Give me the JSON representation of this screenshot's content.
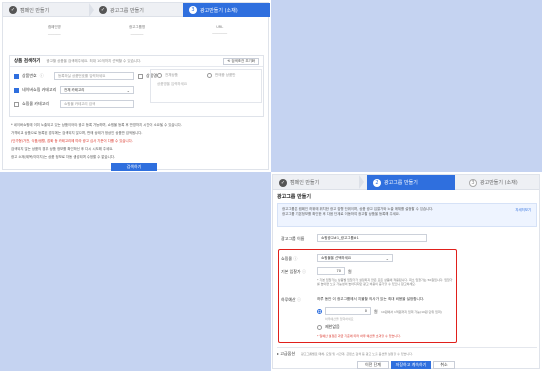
{
  "panel1": {
    "steps": [
      {
        "num": "✓",
        "label": "캠페인 만들기"
      },
      {
        "num": "✓",
        "label": "광고그룹 만들기"
      },
      {
        "num": "3",
        "label": "광고만들기 (소재)"
      }
    ],
    "info": [
      {
        "label": "캠페인명",
        "value": "──────"
      },
      {
        "label": "광고그룹명",
        "value": "──────"
      },
      {
        "label": "URL",
        "value": "───────"
      }
    ],
    "section_title": "상품 검색하기",
    "section_sub": "광고할 상품을 검색해주세요. 최대 10개까지 선택할 수 있습니다.",
    "reset_button": "⟲ 검색조건 초기화",
    "rows": {
      "product_id": {
        "label": "상품번호",
        "placeholder": "등록하실 상품번호를 입력하세요"
      },
      "category": {
        "label": "네이버쇼핑 카테고리",
        "value": "전체 카테고리"
      },
      "mall": {
        "label": "쇼핑몰 카테고리",
        "placeholder": "쇼핑몰 카테고리 검색"
      },
      "product_name": {
        "label": "상품명"
      },
      "right_opt1": "전체상품",
      "right_opt2": "판매중 상품만",
      "right_hint": "상품명을 입력하세요"
    },
    "notes": [
      "* 네이버쇼핑에 이미 노출되고 있는 상품이어야 광고 등록 가능하며, 쇼핑몰 등록 후 반영까지 시간이 소요될 수 있습니다.",
      "가격비교 상품으로 등록된 경우에는 검색되지 않으며, 판매 상태가 정상인 상품만 검색됩니다.",
      "(단가형)가전, 식품/생활, 잡화 등 카테고리에 따라 광고 심사 기준이 다를 수 있습니다.",
      "검색되지 않는 상품의 경우 상품 정보를 확인하신 후 다시 시도해 주세요.",
      "광고 소재(제목/이미지)는 상품 정보로 자동 생성되며 수정할 수 없습니다."
    ],
    "search_button": "검색하기"
  },
  "panel2": {
    "steps": [
      {
        "num": "✓",
        "label": "캠페인 만들기"
      },
      {
        "num": "2",
        "label": "광고그룹 만들기"
      },
      {
        "num": "3",
        "label": "광고만들기 (소재)"
      }
    ],
    "title": "광고그룹 만들기",
    "notice_lines": [
      "광고그룹은 캠페인 하위에 위치한 광고 집행 단위이며, 상품 광고 입찰가와 노출 매체를 설정할 수 있습니다.",
      "광고그룹 기본정보를 확인한 후 다음 단계로 이동하여 광고할 상품을 등록해 주세요."
    ],
    "notice_link": "자세히보기",
    "group_name_label": "광고그룹 이름",
    "group_name_value": "쇼핑광고#1_광고그룹#1",
    "mall_label": "쇼핑몰",
    "mall_value": "쇼핑몰을 선택하세요",
    "bid_label": "기본 입찰가",
    "bid_value": "70",
    "bid_unit": "원",
    "bid_note": "* 기본 입찰가는 상품별 입찰가가 설정되지 않은 모든 상품에 적용됩니다. 최소 입찰가는 50원입니다. 입찰가를 높이면 노출 가능성이 높아지지만 광고 비용이 증가할 수 있으니 참고하세요.",
    "budget_label": "하루예산",
    "budget_desc": "하루 동안 이 광고그룹에서 지불할 의사가 있는 최대 비용을 설정합니다.",
    "budget_value": "0",
    "budget_unit": "원",
    "budget_note": "10원에서 1억원까지 입력 가능(10원 단위 입력)",
    "budget_hint": "하루예산을 입력하세요",
    "unlimited_label": "제한없음",
    "budget_warn": "* 일예산 설정은 과금 기준에 따라 하루 예산을 초과할 수 있습니다.",
    "advanced_label": "고급옵션",
    "advanced_desc": "광고그룹별로 매체, 요일 및 시간대, 콘텐츠 검색 등 광고 노출 옵션을 설정할 수 있습니다.",
    "btn_prev": "이전 단계",
    "btn_save": "저장하고 계속하기",
    "btn_cancel": "취소"
  }
}
